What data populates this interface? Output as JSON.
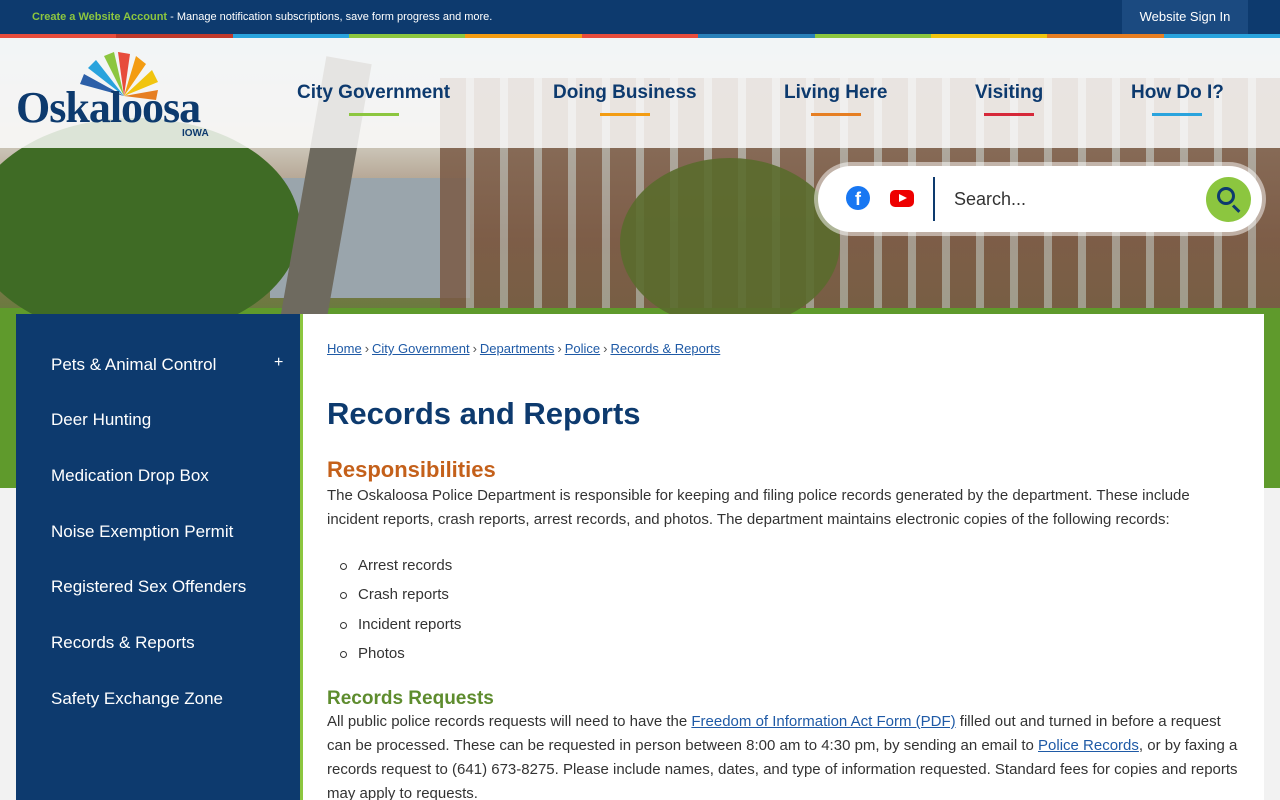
{
  "topbar": {
    "create_account_link": "Create a Website Account",
    "create_account_desc": " - Manage notification subscriptions, save form progress and more.",
    "sign_in": "Website Sign In"
  },
  "colors": {
    "navy": "#0d3a6e",
    "green": "#8cc63f",
    "orange": "#c4601a",
    "link": "#1f5aa6",
    "strip": [
      "#e74c3c",
      "#c0392b",
      "#29a3dd",
      "#8cc63f",
      "#f39c12",
      "#e74c3c",
      "#2980b9",
      "#8cc63f",
      "#f1c40f",
      "#e67e22",
      "#29a3dd"
    ]
  },
  "logo": {
    "name": "Oskaloosa",
    "state": "IOWA"
  },
  "nav": [
    {
      "label": "City Government",
      "underline": "#8cc63f"
    },
    {
      "label": "Doing Business",
      "underline": "#f39c12"
    },
    {
      "label": "Living Here",
      "underline": "#e67e22"
    },
    {
      "label": "Visiting",
      "underline": "#d62839"
    },
    {
      "label": "How Do I?",
      "underline": "#29a3dd"
    }
  ],
  "social": {
    "facebook_icon": "facebook-icon",
    "youtube_icon": "youtube-icon"
  },
  "search": {
    "placeholder": "Search...",
    "icon": "search-icon"
  },
  "sidebar": {
    "items": [
      {
        "label": "Pets & Animal Control",
        "expandable": "+"
      },
      {
        "label": "Deer Hunting"
      },
      {
        "label": "Medication Drop Box"
      },
      {
        "label": "Noise Exemption Permit"
      },
      {
        "label": "Registered Sex Offenders"
      },
      {
        "label": "Records & Reports"
      },
      {
        "label": "Safety Exchange Zone"
      }
    ]
  },
  "breadcrumb": {
    "items": [
      "Home",
      "City Government",
      "Departments",
      "Police",
      "Records & Reports"
    ],
    "separator": "›"
  },
  "page": {
    "title": "Records and Reports",
    "responsibilities": {
      "heading": "Responsibilities",
      "text": "The Oskaloosa Police Department is responsible for keeping and filing police records generated by the department. These include incident reports, crash reports, arrest records, and photos. The department maintains electronic copies of the following records:",
      "list": [
        "Arrest records",
        "Crash reports",
        "Incident reports",
        "Photos"
      ]
    },
    "requests": {
      "heading": "Records Requests",
      "text_1": "All public police records requests will need to have the ",
      "foia_link": "Freedom of Information Act Form (PDF)",
      "text_2": " filled out and turned in before a request can be processed. These can be requested in person between 8:00 am to 4:30 pm, by sending an email to ",
      "email_link": "Police Records",
      "text_3": ", or by faxing a records request to (641) 673-8275. Please include names, dates, and type of information requested. Standard fees for copies and reports may apply to requests."
    }
  }
}
